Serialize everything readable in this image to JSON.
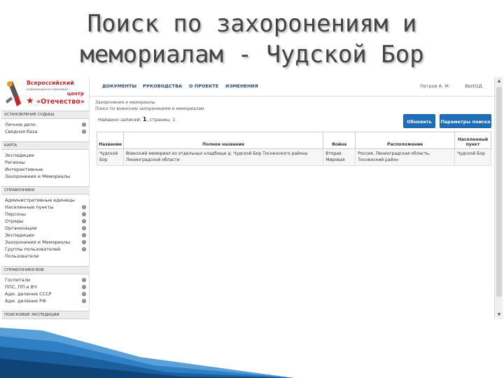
{
  "slide_title": "Поиск по захоронениям и мемориалам - Чудской Бор",
  "logo": {
    "line1": "Всероссийский",
    "line2": "информационно-поисковый",
    "line3": "центр",
    "line4": "«Отечество»"
  },
  "sidebar": {
    "sections": [
      {
        "title": "Установление судьбы",
        "items": [
          {
            "label": "Личное дело",
            "arrow": true
          },
          {
            "label": "Сводная база",
            "arrow": true
          }
        ]
      },
      {
        "title": "Карта",
        "items": [
          {
            "label": "Экспедиции",
            "arrow": false
          },
          {
            "label": "Регионы",
            "arrow": false
          },
          {
            "label": "Интерактивные",
            "arrow": false
          },
          {
            "label": "Захоронения и Мемориалы",
            "arrow": false
          }
        ]
      },
      {
        "title": "Справочники",
        "items": [
          {
            "label": "Административные единицы",
            "arrow": false
          },
          {
            "label": "Населенные пункты",
            "arrow": true
          },
          {
            "label": "Персоны",
            "arrow": true
          },
          {
            "label": "Отряды",
            "arrow": true
          },
          {
            "label": "Организации",
            "arrow": true
          },
          {
            "label": "Экспедиции",
            "arrow": true
          },
          {
            "label": "Захоронения и Мемориалы",
            "arrow": true
          },
          {
            "label": "Группы пользователей",
            "arrow": true
          },
          {
            "label": "Пользователи",
            "arrow": false
          }
        ]
      },
      {
        "title": "Справочники ВОВ",
        "items": [
          {
            "label": "Госпитали",
            "arrow": true
          },
          {
            "label": "ППС, ПП и ВЧ",
            "arrow": true
          },
          {
            "label": "Адм. деление СССР",
            "arrow": true
          },
          {
            "label": "Адм. деление РФ",
            "arrow": true
          }
        ]
      },
      {
        "title": "Поисковые экспедиции",
        "items": []
      }
    ]
  },
  "nav": {
    "items": [
      "ДОКУМЕНТЫ",
      "РУКОВОДСТВА",
      "О ПРОЕКТЕ",
      "ИЗМЕНЕНИЯ"
    ],
    "user": "Петров А. М.",
    "exit": "ВЫХОД"
  },
  "breadcrumb": {
    "line1": "Захоронения и мемориалы",
    "line2": "Поиск по воинским захоронениям и мемориалам"
  },
  "results_info": {
    "prefix": "Найдено записей:",
    "count": "1",
    "pages": ", страниц: 1"
  },
  "buttons": {
    "refresh": "Обновить",
    "params": "Параметры поиска"
  },
  "table": {
    "headers": [
      "Название",
      "Полное название",
      "Война",
      "Расположение",
      "Населенный пункт"
    ],
    "rows": [
      [
        "Чудской Бор",
        "Воинский мемориал из отдельных кладбище д. Чудской Бор Тосненского района Ленинградской области",
        "Вторая Мировая",
        "Россия, Ленинградская область, Тосненский район",
        "Чудской Бор"
      ]
    ]
  },
  "colors": {
    "accent": "#1f6fb8",
    "brand": "#c0272d",
    "nav_text": "#2b4a6b"
  }
}
